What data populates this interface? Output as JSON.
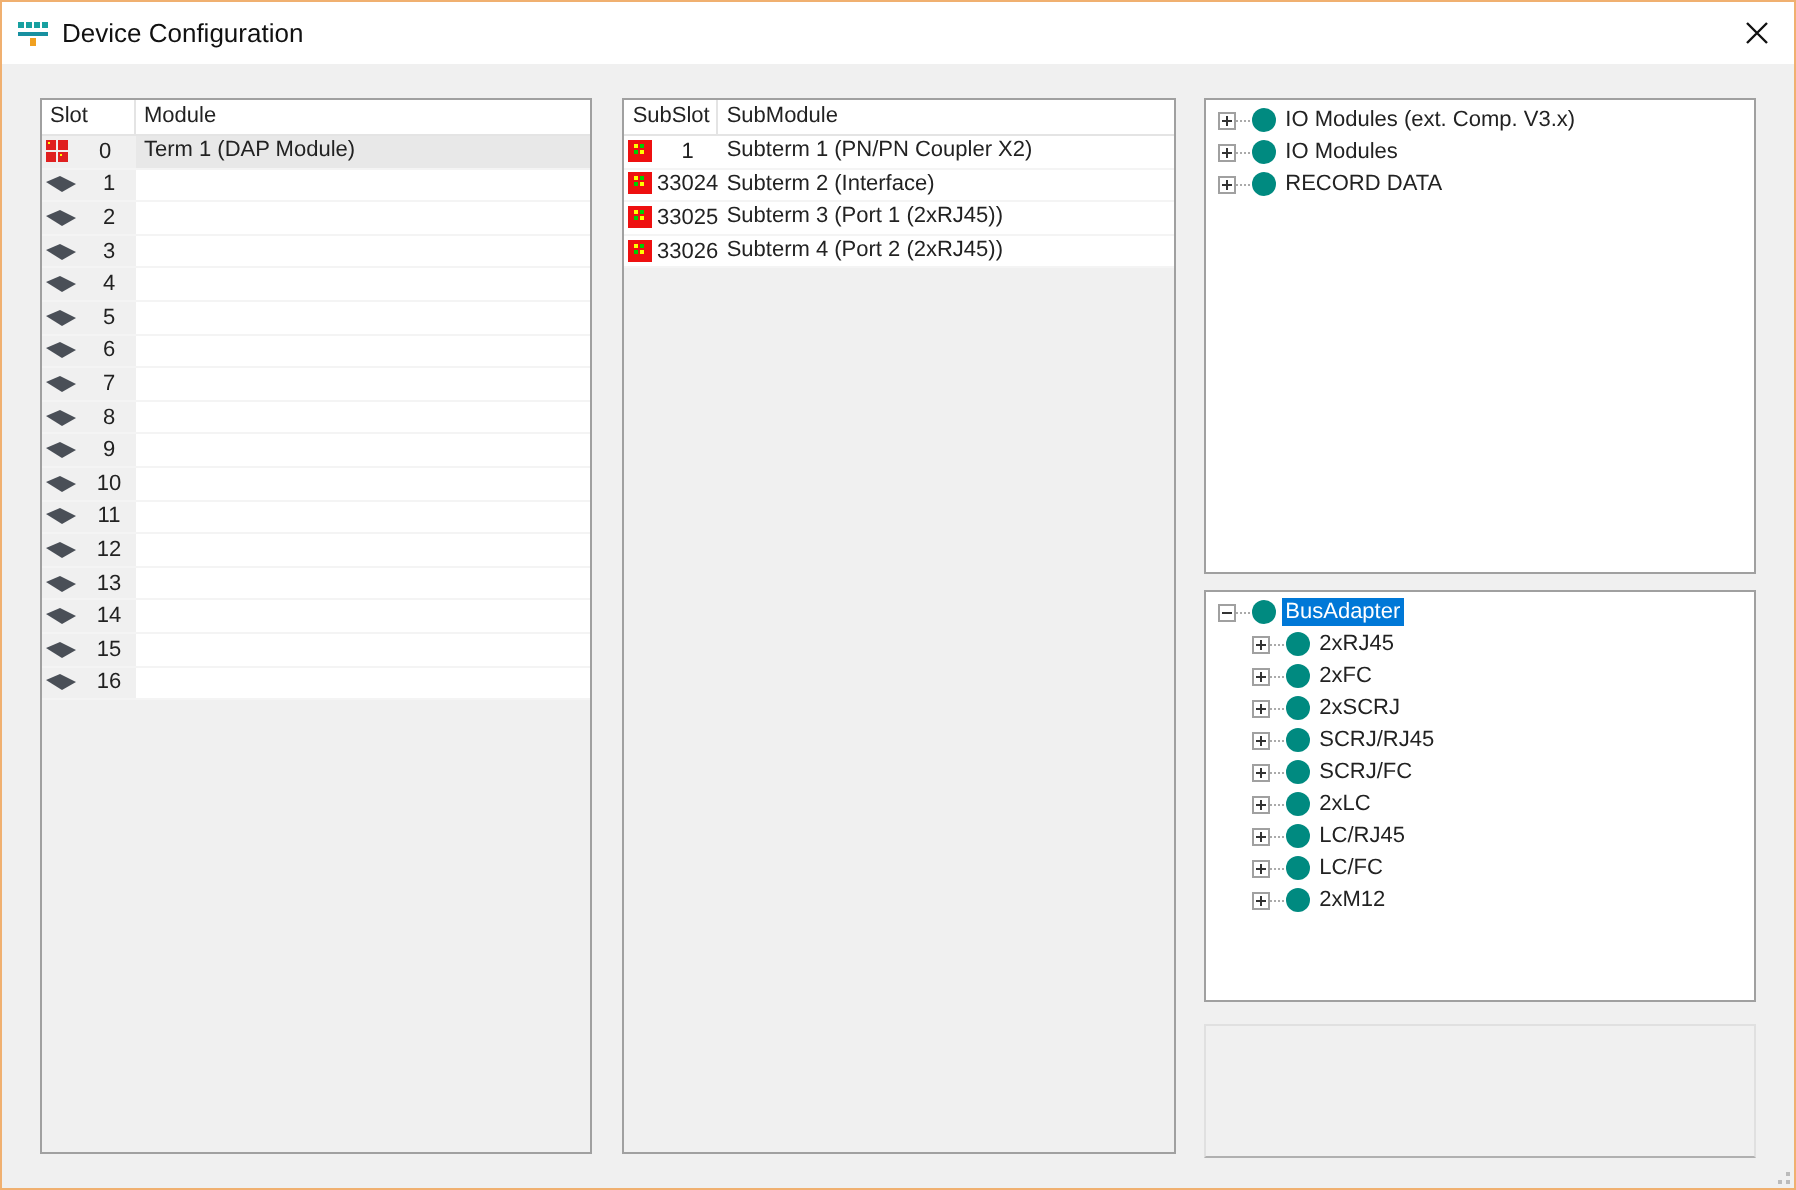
{
  "window": {
    "title": "Device Configuration"
  },
  "slot_table": {
    "columns": [
      "Slot",
      "Module"
    ],
    "rows": [
      {
        "slot": "0",
        "module": "Term 1 (DAP Module)",
        "kind": "module",
        "selected": true
      },
      {
        "slot": "1",
        "kind": "empty",
        "selected": false
      },
      {
        "slot": "2",
        "kind": "empty",
        "selected": false
      },
      {
        "slot": "3",
        "kind": "empty",
        "selected": false
      },
      {
        "slot": "4",
        "kind": "empty",
        "selected": false
      },
      {
        "slot": "5",
        "kind": "empty",
        "selected": false
      },
      {
        "slot": "6",
        "kind": "empty",
        "selected": false
      },
      {
        "slot": "7",
        "kind": "empty",
        "selected": false
      },
      {
        "slot": "8",
        "kind": "empty",
        "selected": false
      },
      {
        "slot": "9",
        "kind": "empty",
        "selected": false
      },
      {
        "slot": "10",
        "kind": "empty",
        "selected": false
      },
      {
        "slot": "11",
        "kind": "empty",
        "selected": false
      },
      {
        "slot": "12",
        "kind": "empty",
        "selected": false
      },
      {
        "slot": "13",
        "kind": "empty",
        "selected": false
      },
      {
        "slot": "14",
        "kind": "empty",
        "selected": false
      },
      {
        "slot": "15",
        "kind": "empty",
        "selected": false
      },
      {
        "slot": "16",
        "kind": "empty",
        "selected": false
      }
    ]
  },
  "subslot_table": {
    "columns": [
      "SubSlot",
      "SubModule"
    ],
    "rows": [
      {
        "slot": "1",
        "module": "Subterm 1 (PN/PN Coupler X2)",
        "kind": "submodule",
        "selected": false
      },
      {
        "slot": "33024",
        "module": "Subterm 2 (Interface)",
        "kind": "submodule",
        "selected": false
      },
      {
        "slot": "33025",
        "module": "Subterm 3 (Port 1 (2xRJ45))",
        "kind": "submodule",
        "selected": false
      },
      {
        "slot": "33026",
        "module": "Subterm 4 (Port 2 (2xRJ45))",
        "kind": "submodule",
        "selected": false
      }
    ]
  },
  "catalog_tree": [
    {
      "label": "IO Modules (ext. Comp. V3.x)",
      "expanded": false,
      "selected": false
    },
    {
      "label": "IO Modules",
      "expanded": false,
      "selected": false
    },
    {
      "label": "RECORD DATA",
      "expanded": false,
      "selected": false
    }
  ],
  "bus_adapter_tree": [
    {
      "label": "BusAdapter",
      "expanded": true,
      "selected": true,
      "children": [
        {
          "label": "2xRJ45",
          "expanded": false,
          "selected": false
        },
        {
          "label": "2xFC",
          "expanded": false,
          "selected": false
        },
        {
          "label": "2xSCRJ",
          "expanded": false,
          "selected": false
        },
        {
          "label": "SCRJ/RJ45",
          "expanded": false,
          "selected": false
        },
        {
          "label": "SCRJ/FC",
          "expanded": false,
          "selected": false
        },
        {
          "label": "2xLC",
          "expanded": false,
          "selected": false
        },
        {
          "label": "LC/RJ45",
          "expanded": false,
          "selected": false
        },
        {
          "label": "LC/FC",
          "expanded": false,
          "selected": false
        },
        {
          "label": "2xM12",
          "expanded": false,
          "selected": false
        }
      ]
    }
  ]
}
